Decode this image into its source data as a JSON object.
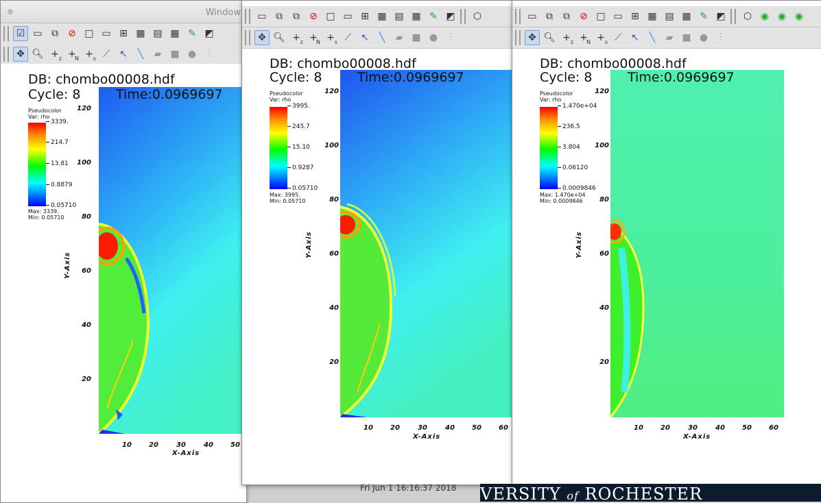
{
  "app": {
    "window_title": "Window",
    "date_text": "Fri Jun  1 16:16:37 2018",
    "banner_text_pre": "VERSITY",
    "banner_text_of": "of",
    "banner_text_post": "ROCHESTER"
  },
  "toolbar": {
    "row1_icons": [
      "active-window-icon",
      "new-window-icon",
      "copy-window-icon",
      "delete-window-icon",
      "layout-1x1-icon",
      "layout-1x2-icon",
      "layout-2x2-icon",
      "layout-2x3-icon",
      "layout-2x4-icon",
      "layout-3x3-icon",
      "lock-view-icon",
      "spin-icon"
    ],
    "row2_icons": [
      "navigate-icon",
      "zoom-icon",
      "zone-pick-icon",
      "node-pick-icon",
      "spreadsheet-pick-icon",
      "curve-pick-icon",
      "lineout-icon",
      "line-icon",
      "plane-icon",
      "box-icon",
      "sphere-icon",
      "tools-icon"
    ],
    "row2_subs": [
      "",
      "",
      "z",
      "N",
      "s",
      "",
      "",
      "",
      "",
      "",
      "",
      ""
    ]
  },
  "panels": [
    {
      "db": "DB: chombo00008.hdf",
      "cycle": "Cycle: 8",
      "time": "Time:0.0969697",
      "legend_title": "Pseudocolor",
      "legend_var": "Var: rho",
      "levels": [
        "3339.",
        "214.7",
        "13.81",
        "0.8879",
        "0.05710"
      ],
      "max": "Max:  3339.",
      "min": "Min:  0.05710",
      "x_label": "X-Axis",
      "y_label": "Y-Axis",
      "x_ticks": [
        "10",
        "20",
        "30",
        "40",
        "50"
      ],
      "y_ticks": [
        "120",
        "100",
        "80",
        "60",
        "40",
        "20"
      ]
    },
    {
      "db": "DB: chombo00008.hdf",
      "cycle": "Cycle: 8",
      "time": "Time:0.0969697",
      "legend_title": "Pseudocolor",
      "legend_var": "Var: rho",
      "levels": [
        "3995.",
        "245.7",
        "15.10",
        "0.9287",
        "0.05710"
      ],
      "max": "Max:  3995.",
      "min": "Min:  0.05710",
      "x_label": "X-Axis",
      "y_label": "Y-Axis",
      "x_ticks": [
        "10",
        "20",
        "30",
        "40",
        "50",
        "60"
      ],
      "y_ticks": [
        "120",
        "100",
        "80",
        "60",
        "40",
        "20"
      ]
    },
    {
      "db": "DB: chombo00008.hdf",
      "cycle": "Cycle: 8",
      "time": "Time:0.0969697",
      "legend_title": "Pseudocolor",
      "legend_var": "Var: rho",
      "levels": [
        "1.470e+04",
        "236.5",
        "3.804",
        "0.06120",
        "0.0009846"
      ],
      "max": "Max:  1.470e+04",
      "min": "Min:  0.0009846",
      "x_label": "X-Axis",
      "y_label": "Y-Axis",
      "x_ticks": [
        "10",
        "20",
        "30",
        "40",
        "50",
        "60"
      ],
      "y_ticks": [
        "120",
        "100",
        "80",
        "60",
        "40",
        "20"
      ]
    }
  ]
}
